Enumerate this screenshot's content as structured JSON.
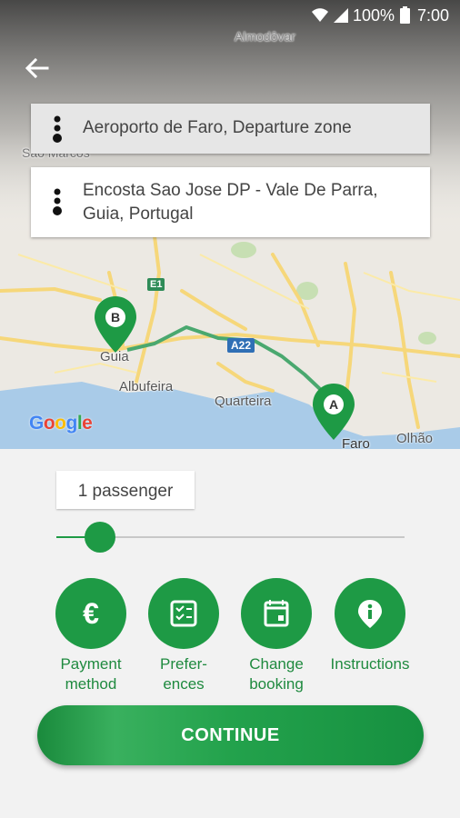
{
  "status_bar": {
    "battery": "100%",
    "time": "7:00"
  },
  "map": {
    "labels": {
      "almodovar": "Almodôvar",
      "sao_marcos": "Sao Marcos",
      "guia": "Guia",
      "albufeira": "Albufeira",
      "quarteira": "Quarteira",
      "faro": "Faro",
      "olhao": "Olhão",
      "e1": "E1",
      "a22": "A22"
    },
    "markers": {
      "a": "A",
      "b": "B"
    },
    "attribution": "Google"
  },
  "route": {
    "origin": "Aeroporto de Faro, Departure zone",
    "destination": "Encosta Sao Jose DP - Vale De Parra, Guia, Portugal"
  },
  "passengers": {
    "label": "1 passenger",
    "value": 1
  },
  "actions": [
    {
      "label": "Payment\nmethod",
      "icon": "euro-icon"
    },
    {
      "label": "Prefer-\nences",
      "icon": "checklist-icon"
    },
    {
      "label": "Change\nbooking",
      "icon": "calendar-icon"
    },
    {
      "label": "Instructions",
      "icon": "info-icon"
    }
  ],
  "continue_label": "CONTINUE",
  "colors": {
    "accent": "#1e9a45",
    "label_green": "#1f8a3f",
    "route": "#4aa86f"
  }
}
